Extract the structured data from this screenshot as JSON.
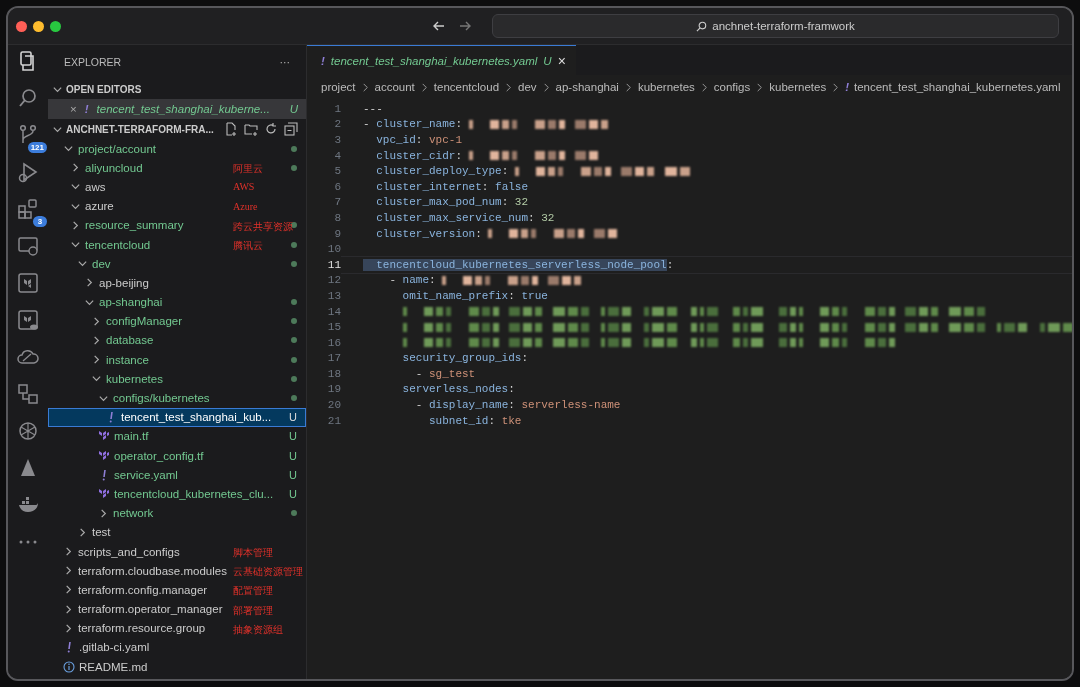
{
  "window": {
    "search": "anchnet-terraform-framwork"
  },
  "activity_bar": [
    {
      "kind": "explorer",
      "selected": true
    },
    {
      "kind": "search",
      "selected": false
    },
    {
      "kind": "source-control",
      "selected": false,
      "badge": "121"
    },
    {
      "kind": "run",
      "selected": false
    },
    {
      "kind": "extensions",
      "selected": false,
      "badge": "3"
    },
    {
      "kind": "remote",
      "selected": false
    },
    {
      "kind": "terraform",
      "selected": false
    },
    {
      "kind": "terraform-cloud",
      "selected": false
    },
    {
      "kind": "cloud",
      "selected": false
    },
    {
      "kind": "diagram",
      "selected": false
    },
    {
      "kind": "ai",
      "selected": false
    },
    {
      "kind": "cone",
      "selected": false
    },
    {
      "kind": "docker",
      "selected": false
    },
    {
      "kind": "more",
      "selected": false
    }
  ],
  "sidebar": {
    "title": "EXPLORER",
    "more": "···",
    "open_editors": {
      "title": "OPEN EDITORS",
      "expanded": true,
      "items": [
        {
          "close": "×",
          "icon": "!",
          "name": "tencent_test_shanghai_kuberne...",
          "badge": "U"
        }
      ]
    },
    "project": {
      "title": "ANCHNET-TERRAFORM-FRA...",
      "expanded": true,
      "tree": [
        {
          "label": "project/account",
          "kind": "folder",
          "expanded": true,
          "modified": true,
          "dot": true,
          "selected": false,
          "children": [
            {
              "label": "aliyuncloud",
              "kind": "folder",
              "expanded": false,
              "modified": true,
              "dot": true,
              "selected": false,
              "note": "阿里云"
            },
            {
              "label": "aws",
              "kind": "folder",
              "expanded": true,
              "modified": false,
              "selected": false,
              "note": "AWS"
            },
            {
              "label": "azure",
              "kind": "folder",
              "expanded": true,
              "modified": false,
              "selected": false,
              "note": "Azure"
            },
            {
              "label": "resource_summary",
              "kind": "folder",
              "expanded": false,
              "modified": true,
              "dot": true,
              "selected": false,
              "note": "跨云共享资源"
            },
            {
              "label": "tencentcloud",
              "kind": "folder",
              "expanded": true,
              "modified": true,
              "dot": true,
              "selected": false,
              "note": "腾讯云",
              "children": [
                {
                  "label": "dev",
                  "kind": "folder",
                  "expanded": true,
                  "modified": true,
                  "dot": true,
                  "selected": false,
                  "children": [
                    {
                      "label": "ap-beijing",
                      "kind": "folder",
                      "expanded": false,
                      "modified": false,
                      "selected": false
                    },
                    {
                      "label": "ap-shanghai",
                      "kind": "folder",
                      "expanded": true,
                      "modified": true,
                      "dot": true,
                      "selected": false,
                      "children": [
                        {
                          "label": "configManager",
                          "kind": "folder",
                          "expanded": false,
                          "modified": true,
                          "dot": true,
                          "selected": false
                        },
                        {
                          "label": "database",
                          "kind": "folder",
                          "expanded": false,
                          "modified": true,
                          "dot": true,
                          "selected": false
                        },
                        {
                          "label": "instance",
                          "kind": "folder",
                          "expanded": false,
                          "modified": true,
                          "dot": true,
                          "selected": false
                        },
                        {
                          "label": "kubernetes",
                          "kind": "folder",
                          "expanded": true,
                          "modified": true,
                          "dot": true,
                          "selected": false,
                          "children": [
                            {
                              "label": "configs/kubernetes",
                              "kind": "folder",
                              "expanded": true,
                              "modified": true,
                              "dot": true,
                              "selected": false,
                              "children": [
                                {
                                  "label": "tencent_test_shanghai_kub...",
                                  "kind": "yaml",
                                  "modified": true,
                                  "badge": "U",
                                  "dot": false,
                                  "selected": true
                                }
                              ]
                            },
                            {
                              "label": "main.tf",
                              "kind": "tf",
                              "modified": true,
                              "badge": "U",
                              "dot": false,
                              "selected": false
                            },
                            {
                              "label": "operator_config.tf",
                              "kind": "tf",
                              "modified": true,
                              "badge": "U",
                              "dot": false,
                              "selected": false
                            },
                            {
                              "label": "service.yaml",
                              "kind": "yaml",
                              "modified": true,
                              "badge": "U",
                              "dot": false,
                              "selected": false
                            },
                            {
                              "label": "tencentcloud_kubernetes_clu...",
                              "kind": "tf",
                              "modified": true,
                              "badge": "U",
                              "dot": false,
                              "selected": false
                            },
                            {
                              "label": "network",
                              "kind": "folder",
                              "expanded": false,
                              "modified": true,
                              "dot": true,
                              "selected": false
                            }
                          ]
                        }
                      ]
                    }
                  ]
                },
                {
                  "label": "test",
                  "kind": "folder",
                  "expanded": false,
                  "modified": false,
                  "selected": false
                }
              ]
            }
          ]
        },
        {
          "label": "scripts_and_configs",
          "kind": "folder",
          "expanded": false,
          "modified": false,
          "selected": false,
          "note": "脚本管理"
        },
        {
          "label": "terraform.cloudbase.modules",
          "kind": "folder",
          "expanded": false,
          "modified": false,
          "selected": false,
          "note": "云基础资源管理"
        },
        {
          "label": "terraform.config.manager",
          "kind": "folder",
          "expanded": false,
          "modified": false,
          "selected": false,
          "note": "配置管理"
        },
        {
          "label": "terraform.operator_manager",
          "kind": "folder",
          "expanded": false,
          "modified": false,
          "selected": false,
          "note": "部署管理"
        },
        {
          "label": "terraform.resource.group",
          "kind": "folder",
          "expanded": false,
          "modified": false,
          "selected": false,
          "note": "抽象资源组"
        },
        {
          "label": ".gitlab-ci.yaml",
          "kind": "yaml",
          "modified": false,
          "selected": false
        },
        {
          "label": "README.md",
          "kind": "info",
          "modified": false,
          "selected": false
        }
      ]
    }
  },
  "editor": {
    "tabs": [
      {
        "icon": "!",
        "name": "tencent_test_shanghai_kubernetes.yaml",
        "badge": "U",
        "close": "×",
        "selected": true
      }
    ],
    "breadcrumb": [
      "project",
      "account",
      "tencentcloud",
      "dev",
      "ap-shanghai",
      "kubernetes",
      "configs",
      "kubernetes",
      "tencent_test_shanghai_kubernetes.yaml"
    ],
    "breadcrumb_icon": "!",
    "lines": [
      {
        "number": "1",
        "current": false,
        "tokens": [
          {
            "kind": "punct",
            "text": "---"
          }
        ]
      },
      {
        "number": "2",
        "current": false,
        "tokens": [
          {
            "kind": "punct",
            "text": "- "
          },
          {
            "kind": "key",
            "text": "cluster_name"
          },
          {
            "kind": "punct",
            "text": ": "
          },
          {
            "kind": "redacted"
          }
        ]
      },
      {
        "number": "3",
        "current": false,
        "tokens": [
          {
            "kind": "key",
            "text": "  vpc_id"
          },
          {
            "kind": "punct",
            "text": ": "
          },
          {
            "kind": "string",
            "text": "vpc-1"
          }
        ]
      },
      {
        "number": "4",
        "current": false,
        "tokens": [
          {
            "kind": "key",
            "text": "  cluster_cidr"
          },
          {
            "kind": "punct",
            "text": ": "
          },
          {
            "kind": "redacted"
          }
        ]
      },
      {
        "number": "5",
        "current": false,
        "tokens": [
          {
            "kind": "key",
            "text": "  cluster_deploy_type"
          },
          {
            "kind": "punct",
            "text": ": "
          },
          {
            "kind": "redacted"
          }
        ]
      },
      {
        "number": "6",
        "current": false,
        "tokens": [
          {
            "kind": "key",
            "text": "  cluster_internet"
          },
          {
            "kind": "punct",
            "text": ": "
          },
          {
            "kind": "bool",
            "text": "false"
          }
        ]
      },
      {
        "number": "7",
        "current": false,
        "tokens": [
          {
            "kind": "key",
            "text": "  cluster_max_pod_num"
          },
          {
            "kind": "punct",
            "text": ": "
          },
          {
            "kind": "number",
            "text": "32"
          }
        ]
      },
      {
        "number": "8",
        "current": false,
        "tokens": [
          {
            "kind": "key",
            "text": "  cluster_max_service_num"
          },
          {
            "kind": "punct",
            "text": ": "
          },
          {
            "kind": "number",
            "text": "32"
          }
        ]
      },
      {
        "number": "9",
        "current": false,
        "tokens": [
          {
            "kind": "key",
            "text": "  cluster_version"
          },
          {
            "kind": "punct",
            "text": ": "
          },
          {
            "kind": "redacted"
          }
        ]
      },
      {
        "number": "10",
        "current": false
      },
      {
        "number": "11",
        "current": true,
        "tokens": [
          {
            "kind": "key",
            "text": "  tencentcloud_kubernetes_serverless_node_pool"
          },
          {
            "kind": "punct",
            "text": ":"
          }
        ]
      },
      {
        "number": "12",
        "current": false,
        "tokens": [
          {
            "kind": "punct",
            "text": "    - "
          },
          {
            "kind": "key",
            "text": "name"
          },
          {
            "kind": "punct",
            "text": ": "
          },
          {
            "kind": "redacted"
          }
        ]
      },
      {
        "number": "13",
        "current": false,
        "tokens": [
          {
            "kind": "key",
            "text": "      omit_name_prefix"
          },
          {
            "kind": "punct",
            "text": ": "
          },
          {
            "kind": "bool",
            "text": "true"
          }
        ]
      },
      {
        "number": "14",
        "current": false,
        "tokens": [
          {
            "kind": "redacted-comment"
          }
        ]
      },
      {
        "number": "15",
        "current": false,
        "tokens": [
          {
            "kind": "redacted-comment"
          }
        ]
      },
      {
        "number": "16",
        "current": false,
        "tokens": [
          {
            "kind": "redacted-comment"
          }
        ]
      },
      {
        "number": "17",
        "current": false,
        "tokens": [
          {
            "kind": "key",
            "text": "      security_group_ids"
          },
          {
            "kind": "punct",
            "text": ":"
          }
        ]
      },
      {
        "number": "18",
        "current": false,
        "tokens": [
          {
            "kind": "punct",
            "text": "        - "
          },
          {
            "kind": "string",
            "text": "sg_test"
          }
        ]
      },
      {
        "number": "19",
        "current": false,
        "tokens": [
          {
            "kind": "key",
            "text": "      serverless_nodes"
          },
          {
            "kind": "punct",
            "text": ":"
          }
        ]
      },
      {
        "number": "20",
        "current": false,
        "tokens": [
          {
            "kind": "punct",
            "text": "        - "
          },
          {
            "kind": "key",
            "text": "display_name"
          },
          {
            "kind": "punct",
            "text": ": "
          },
          {
            "kind": "string",
            "text": "serverless-name"
          }
        ]
      },
      {
        "number": "21",
        "current": false,
        "tokens": [
          {
            "kind": "key",
            "text": "          subnet_id"
          },
          {
            "kind": "punct",
            "text": ": "
          },
          {
            "kind": "string",
            "text": "tke"
          }
        ]
      }
    ]
  }
}
